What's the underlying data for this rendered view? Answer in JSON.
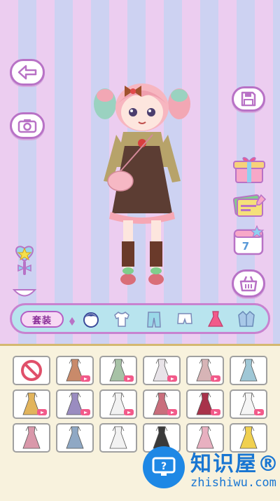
{
  "toolbar": {
    "outfit_label": "套装"
  },
  "icons": {
    "back": "back-arrow-icon",
    "camera": "camera-icon",
    "save": "save-floppy-icon",
    "gift": "gift-box-icon",
    "cards": "cards-icon",
    "calendar": "calendar-icon",
    "calendar_day": "7",
    "shop": "shop-basket-icon",
    "wand": "magic-wand-icon",
    "collapse": "collapse-arrow-icon"
  },
  "tabs": [
    "face",
    "tops",
    "pants",
    "shorts",
    "dress",
    "jacket"
  ],
  "items": [
    {
      "type": "none"
    },
    {
      "type": "dress",
      "color": "#c98a6a",
      "ad": true
    },
    {
      "type": "dress",
      "color": "#a7c2a6",
      "ad": true
    },
    {
      "type": "dress",
      "color": "#e8e3e8",
      "ad": true
    },
    {
      "type": "dress",
      "color": "#d7b4b6",
      "ad": true
    },
    {
      "type": "dress",
      "color": "#9fc7d6",
      "ad": false
    },
    {
      "type": "dress",
      "color": "#e2b45c",
      "ad": true
    },
    {
      "type": "dress",
      "color": "#9a8cc0",
      "ad": true
    },
    {
      "type": "dress",
      "color": "#f2f2f2",
      "ad": true
    },
    {
      "type": "dress",
      "color": "#c96e7c",
      "ad": true
    },
    {
      "type": "dress",
      "color": "#a8324a",
      "ad": true
    },
    {
      "type": "dress",
      "color": "#f5f5f5",
      "ad": true
    },
    {
      "type": "dress",
      "color": "#d998aa",
      "ad": false
    },
    {
      "type": "dress",
      "color": "#8fa8c4",
      "ad": false
    },
    {
      "type": "dress",
      "color": "#f2f2f2",
      "ad": false
    },
    {
      "type": "dress",
      "color": "#3a3a3a",
      "ad": false
    },
    {
      "type": "dress",
      "color": "#e8b0c0",
      "ad": false
    },
    {
      "type": "dress",
      "color": "#f0d050",
      "ad": false
    }
  ],
  "watermark": {
    "title": "知识屋®",
    "url": "zhishiwu.com"
  }
}
